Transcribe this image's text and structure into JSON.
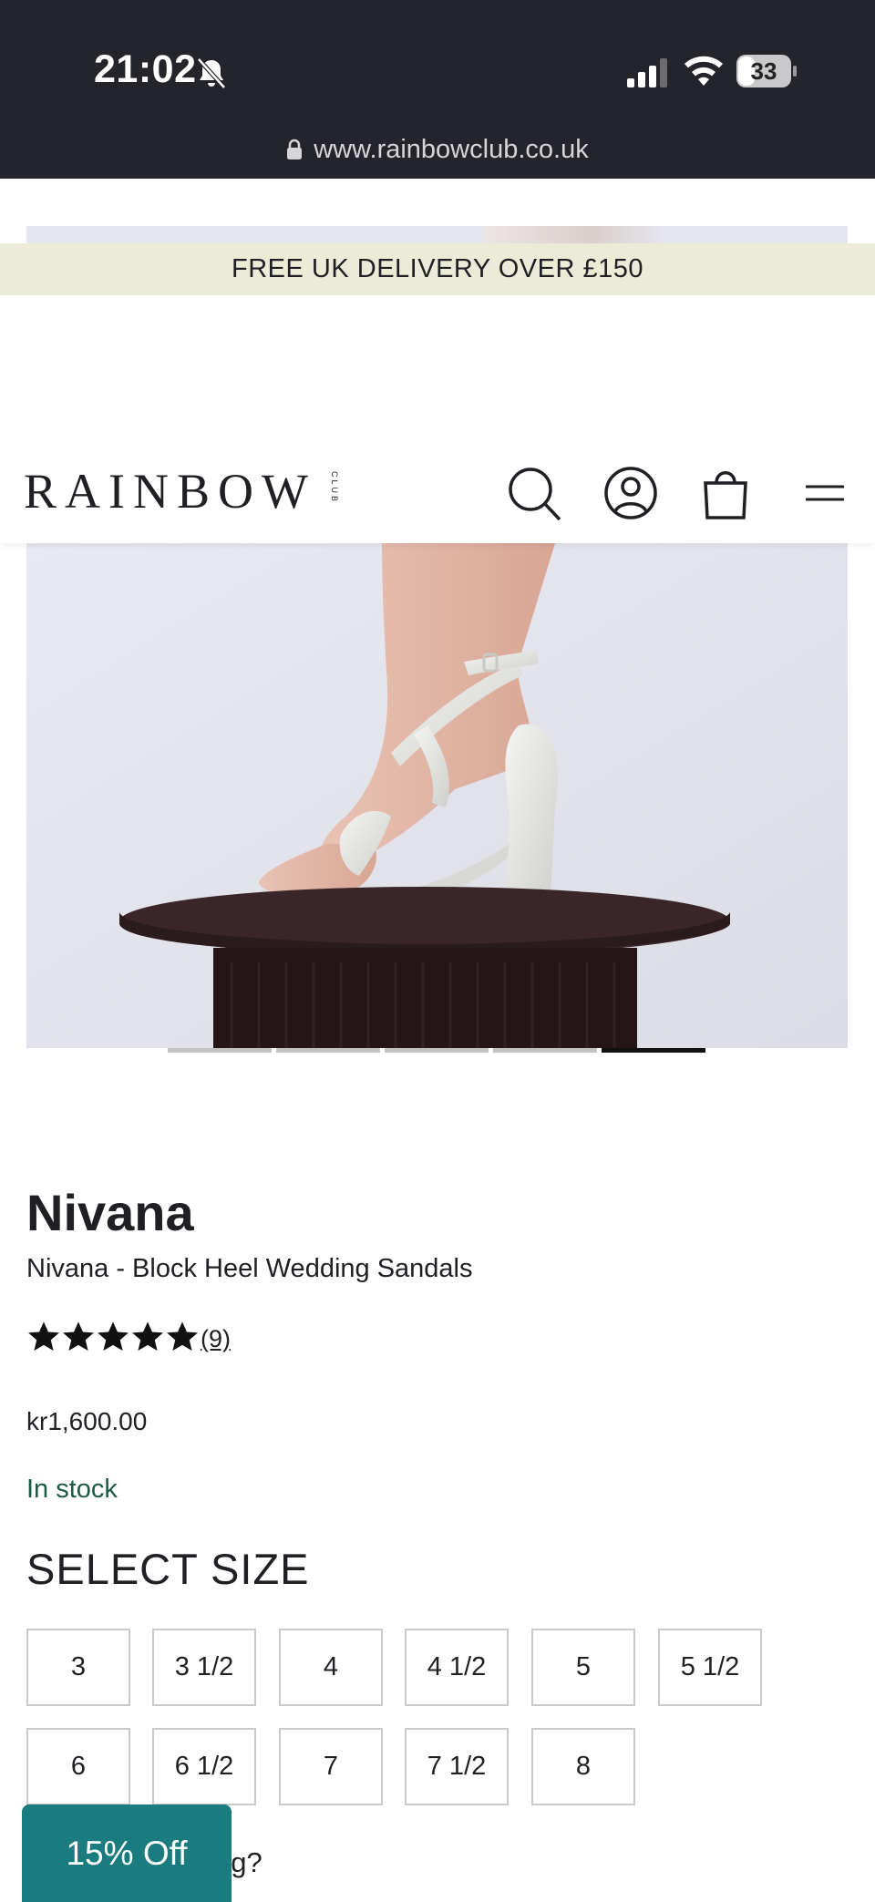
{
  "status_bar": {
    "time": "21:02",
    "battery": "33",
    "battery_level": 0.33,
    "url": "www.rainbowclub.co.uk",
    "icons": [
      "bell-muted-icon",
      "signal-icon",
      "wifi-icon",
      "battery-icon",
      "lock-icon"
    ]
  },
  "promo": {
    "text": "FREE UK DELIVERY OVER £150"
  },
  "header": {
    "logo": "RAINBOW",
    "logo_sub": "CLUB",
    "icons": [
      "search-icon",
      "account-icon",
      "bag-icon",
      "menu-icon"
    ]
  },
  "gallery": {
    "slides": 5,
    "active_slide": 5
  },
  "product": {
    "name": "Nivana",
    "subtitle": "Nivana - Block Heel Wedding Sandals",
    "rating": 5,
    "review_count": "(9)",
    "price": "kr1,600.00",
    "stock": "In stock"
  },
  "size_selector": {
    "heading": "SELECT SIZE",
    "sizes": [
      "3",
      "3 1/2",
      "4",
      "4 1/2",
      "5",
      "5 1/2",
      "6",
      "6 1/2",
      "7",
      "7 1/2",
      "8"
    ]
  },
  "footer_partial_text": "ng?",
  "discount_tab": {
    "label": "15% Off"
  },
  "colors": {
    "status_bar": "#24242b",
    "promo_bg": "#ebebd7",
    "stock_green": "#1c5a44",
    "discount_teal": "#1a7c7f"
  }
}
